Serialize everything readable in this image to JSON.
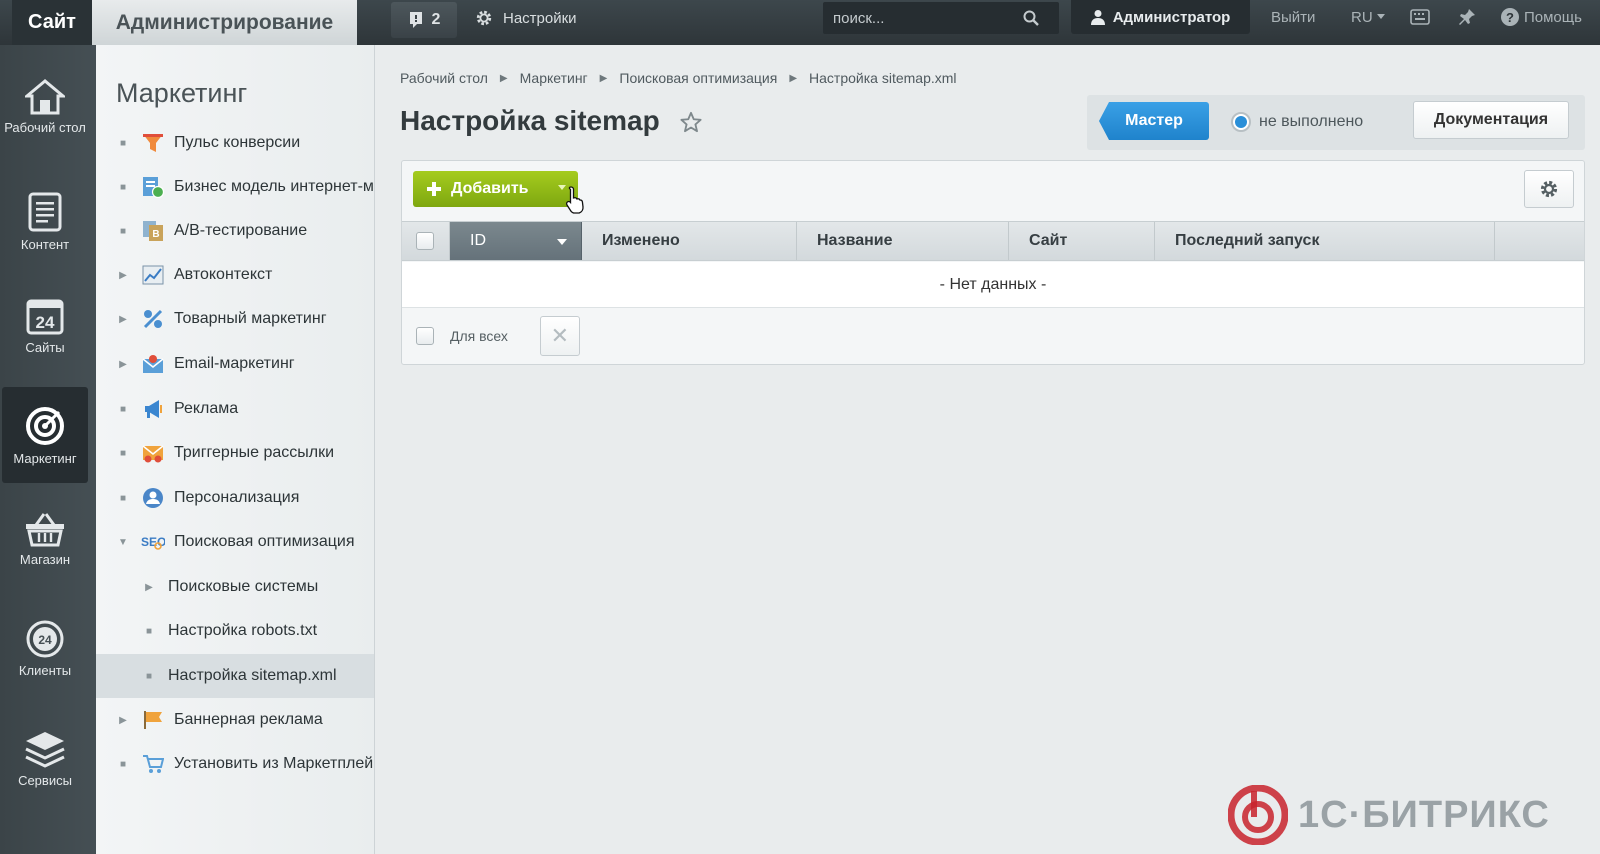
{
  "topbar": {
    "site_label": "Сайт",
    "admin_label": "Администрирование",
    "notifications_count": "2",
    "settings_label": "Настройки",
    "search_placeholder": "поиск...",
    "user_label": "Администратор",
    "logout_label": "Выйти",
    "lang_label": "RU",
    "help_label": "Помощь"
  },
  "rail": {
    "items": [
      {
        "label": "Рабочий стол",
        "icon": "house-icon"
      },
      {
        "label": "Контент",
        "icon": "document-icon"
      },
      {
        "label": "Сайты",
        "icon": "calendar-24-icon"
      },
      {
        "label": "Маркетинг",
        "icon": "target-icon",
        "active": true
      },
      {
        "label": "Магазин",
        "icon": "basket-icon"
      },
      {
        "label": "Клиенты",
        "icon": "clients-24-icon"
      },
      {
        "label": "Сервисы",
        "icon": "layers-icon"
      }
    ]
  },
  "menu": {
    "title": "Маркетинг",
    "items": [
      {
        "label": "Пульс конверсии",
        "marker": "bullet",
        "icon": "funnel-icon"
      },
      {
        "label": "Бизнес модель интернет-м",
        "marker": "bullet",
        "icon": "business-model-icon"
      },
      {
        "label": "A/B-тестирование",
        "marker": "bullet",
        "icon": "ab-test-icon"
      },
      {
        "label": "Автоконтекст",
        "marker": "arrow",
        "icon": "chart-icon"
      },
      {
        "label": "Товарный маркетинг",
        "marker": "arrow",
        "icon": "percent-icon"
      },
      {
        "label": "Email-маркетинг",
        "marker": "arrow",
        "icon": "email-icon"
      },
      {
        "label": "Реклама",
        "marker": "bullet",
        "icon": "megaphone-icon"
      },
      {
        "label": "Триггерные рассылки",
        "marker": "bullet",
        "icon": "trigger-mail-icon"
      },
      {
        "label": "Персонализация",
        "marker": "bullet",
        "icon": "person-icon"
      },
      {
        "label": "Поисковая оптимизация",
        "marker": "open",
        "icon": "seo-icon"
      },
      {
        "label": "Поисковые системы",
        "marker": "arrow",
        "sub": true
      },
      {
        "label": "Настройка robots.txt",
        "marker": "bullet",
        "sub": true
      },
      {
        "label": "Настройка sitemap.xml",
        "marker": "bullet",
        "sub": true,
        "active": true
      },
      {
        "label": "Баннерная реклама",
        "marker": "arrow",
        "icon": "banner-icon"
      },
      {
        "label": "Установить из Маркетплей",
        "marker": "bullet",
        "icon": "cart-icon"
      }
    ]
  },
  "breadcrumbs": [
    "Рабочий стол",
    "Маркетинг",
    "Поисковая оптимизация",
    "Настройка sitemap.xml"
  ],
  "page": {
    "title": "Настройка sitemap"
  },
  "wizard": {
    "button_label": "Мастер",
    "status_label": "не выполнено",
    "docs_label": "Документация"
  },
  "grid": {
    "add_label": "Добавить",
    "columns": [
      "ID",
      "Изменено",
      "Название",
      "Сайт",
      "Последний запуск"
    ],
    "empty_text": "- Нет данных -",
    "for_all_label": "Для всех",
    "delete_glyph": "✕"
  },
  "brand": {
    "name": "1С·БИТРИКС"
  },
  "colors": {
    "accent_green": "#8ab514",
    "accent_blue": "#2a8fd8",
    "brand_red": "#c8232c"
  }
}
